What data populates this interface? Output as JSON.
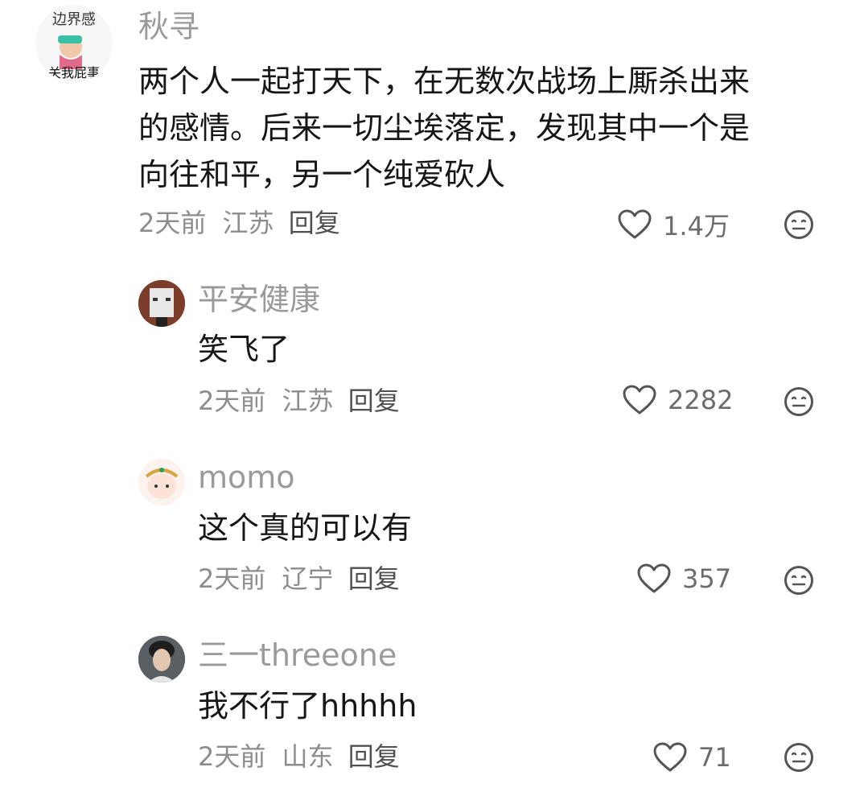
{
  "comments": [
    {
      "avatar_text": {
        "top": "边界感",
        "bottom": "关我屁事"
      },
      "username": "秋寻",
      "lines": [
        "两个人一起打天下，在无数次战场上厮杀出来",
        "的感情。后来一切尘埃落定，发现其中一个是",
        "向往和平，另一个纯爱砍人"
      ],
      "time": "2天前",
      "location": "江苏",
      "reply_label": "回复",
      "likes": "1.4万"
    },
    {
      "username": "平安健康",
      "text": "笑飞了",
      "time": "2天前",
      "location": "江苏",
      "reply_label": "回复",
      "likes": "2282"
    },
    {
      "username": "momo",
      "text": "这个真的可以有",
      "time": "2天前",
      "location": "辽宁",
      "reply_label": "回复",
      "likes": "357"
    },
    {
      "username": "三一threeone",
      "text": "我不行了hhhhh",
      "time": "2天前",
      "location": "山东",
      "reply_label": "回复",
      "likes": "71"
    }
  ],
  "icons": {
    "like": "heart-outline-icon",
    "dislike": "neutral-face-icon"
  },
  "colors": {
    "username": "#9a9a9a",
    "text": "#161616",
    "meta": "#8d8d8d",
    "reply": "#505050"
  }
}
